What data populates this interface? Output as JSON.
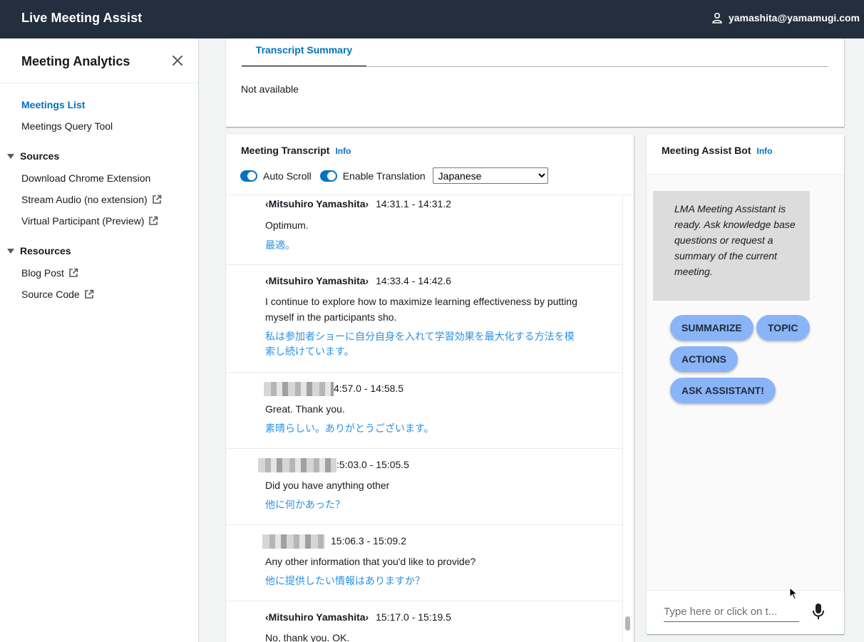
{
  "app": {
    "title": "Live Meeting Assist",
    "user": "yamashita@yamamugi.com"
  },
  "sidenav": {
    "header": "Meeting Analytics",
    "items": [
      {
        "label": "Meetings List",
        "active": true
      },
      {
        "label": "Meetings Query Tool"
      }
    ],
    "sections": [
      {
        "label": "Sources",
        "items": [
          {
            "label": "Download Chrome Extension"
          },
          {
            "label": "Stream Audio (no extension)",
            "external": true
          },
          {
            "label": "Virtual Participant (Preview)",
            "external": true
          }
        ]
      },
      {
        "label": "Resources",
        "items": [
          {
            "label": "Blog Post",
            "external": true
          },
          {
            "label": "Source Code",
            "external": true
          }
        ]
      }
    ]
  },
  "summary": {
    "tab_label": "Transcript Summary",
    "content": "Not available"
  },
  "transcript": {
    "title": "Meeting Transcript",
    "info": "Info",
    "auto_scroll_label": "Auto Scroll",
    "translation_label": "Enable Translation",
    "language": "Japanese",
    "entries": [
      {
        "speaker": "‹Mitsuhiro Yamashita›",
        "time": "14:31.1 - 14:31.2",
        "text": "Optimum.",
        "translation": "最適。"
      },
      {
        "speaker": "‹Mitsuhiro Yamashita›",
        "time": "14:33.4 - 14:42.6",
        "text": "I continue to explore how to maximize learning effectiveness by putting myself in the participants sho.",
        "translation": "私は参加者ショーに自分自身を入れて学習効果を最大化する方法を模索し続けています。"
      },
      {
        "speaker": "",
        "time": "4:57.0 - 14:58.5",
        "text": "Great. Thank you.",
        "translation": "素晴らしい。ありがとうございます。"
      },
      {
        "speaker": "",
        "time": ":5:03.0 - 15:05.5",
        "text": "Did you have anything other",
        "translation": "他に何かあった？"
      },
      {
        "speaker": "",
        "time": "15:06.3 - 15:09.2",
        "text": "Any other information that you'd like to provide?",
        "translation": "他に提供したい情報はありますか？"
      },
      {
        "speaker": "‹Mitsuhiro Yamashita›",
        "time": "15:17.0 - 15:19.5",
        "text": "No, thank you. OK.",
        "translation": ""
      }
    ]
  },
  "bot": {
    "title": "Meeting Assist Bot",
    "info": "Info",
    "message": "LMA Meeting Assistant is ready. Ask knowledge base questions or request a summary of the current meeting.",
    "buttons": {
      "summarize": "SUMMARIZE",
      "topic": "TOPIC",
      "actions": "ACTIONS",
      "ask": "ASK ASSISTANT!"
    },
    "input_placeholder": "Type here or click on t..."
  },
  "colors": {
    "topbar": "#232f3e",
    "link": "#0073bb",
    "translation": "#2a92e6",
    "pill": "#8ab4f8"
  }
}
